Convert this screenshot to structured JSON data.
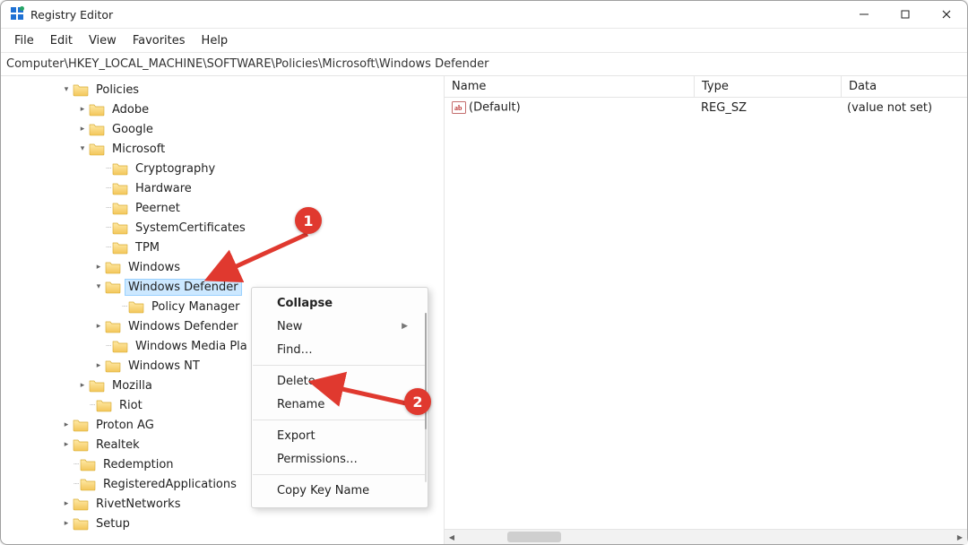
{
  "window": {
    "title": "Registry Editor"
  },
  "menu": {
    "items": [
      "File",
      "Edit",
      "View",
      "Favorites",
      "Help"
    ]
  },
  "addressbar": {
    "path": "Computer\\HKEY_LOCAL_MACHINE\\SOFTWARE\\Policies\\Microsoft\\Windows Defender"
  },
  "tree": {
    "nodes": [
      {
        "pad": 66,
        "chev": "open",
        "label": "Policies",
        "tline": ""
      },
      {
        "pad": 84,
        "chev": "closed",
        "label": "Adobe",
        "tline": ""
      },
      {
        "pad": 84,
        "chev": "closed",
        "label": "Google",
        "tline": ""
      },
      {
        "pad": 84,
        "chev": "open",
        "label": "Microsoft",
        "tline": ""
      },
      {
        "pad": 102,
        "chev": "none",
        "label": "Cryptography",
        "tline": "┈"
      },
      {
        "pad": 102,
        "chev": "none",
        "label": "Hardware",
        "tline": "┈"
      },
      {
        "pad": 102,
        "chev": "none",
        "label": "Peernet",
        "tline": "┈"
      },
      {
        "pad": 102,
        "chev": "none",
        "label": "SystemCertificates",
        "tline": "┈"
      },
      {
        "pad": 102,
        "chev": "none",
        "label": "TPM",
        "tline": "┈"
      },
      {
        "pad": 102,
        "chev": "closed",
        "label": "Windows",
        "tline": ""
      },
      {
        "pad": 102,
        "chev": "open",
        "label": "Windows Defender",
        "tline": "",
        "selected": true
      },
      {
        "pad": 120,
        "chev": "none",
        "label": "Policy Manager",
        "tline": "┈"
      },
      {
        "pad": 102,
        "chev": "closed",
        "label": "Windows Defender Security Center",
        "tline": "",
        "clip": "Windows Defender"
      },
      {
        "pad": 102,
        "chev": "none",
        "label": "Windows Media Player",
        "tline": "┈",
        "clip": "Windows Media Pla"
      },
      {
        "pad": 102,
        "chev": "closed",
        "label": "Windows NT",
        "tline": ""
      },
      {
        "pad": 84,
        "chev": "closed",
        "label": "Mozilla",
        "tline": ""
      },
      {
        "pad": 84,
        "chev": "none",
        "label": "Riot",
        "tline": "┈"
      },
      {
        "pad": 66,
        "chev": "closed",
        "label": "Proton AG",
        "tline": ""
      },
      {
        "pad": 66,
        "chev": "closed",
        "label": "Realtek",
        "tline": ""
      },
      {
        "pad": 66,
        "chev": "none",
        "label": "Redemption",
        "tline": "┈"
      },
      {
        "pad": 66,
        "chev": "none",
        "label": "RegisteredApplications",
        "tline": "┈"
      },
      {
        "pad": 66,
        "chev": "closed",
        "label": "RivetNetworks",
        "tline": ""
      },
      {
        "pad": 66,
        "chev": "closed",
        "label": "Setup",
        "tline": ""
      }
    ]
  },
  "details": {
    "columns": {
      "name": "Name",
      "type": "Type",
      "data": "Data"
    },
    "col_widths": {
      "name": 270,
      "type": 155,
      "data": 160
    },
    "rows": [
      {
        "name": "(Default)",
        "type": "REG_SZ",
        "data": "(value not set)"
      }
    ]
  },
  "ctxmenu": {
    "items": [
      {
        "label": "Collapse",
        "bold": true
      },
      {
        "label": "New",
        "submenu": true
      },
      {
        "label": "Find…"
      },
      {
        "sep": true
      },
      {
        "label": "Delete"
      },
      {
        "label": "Rename"
      },
      {
        "sep": true
      },
      {
        "label": "Export"
      },
      {
        "label": "Permissions…"
      },
      {
        "sep": true
      },
      {
        "label": "Copy Key Name"
      }
    ]
  },
  "annotations": {
    "badge1": "1",
    "badge2": "2",
    "arrow_color": "#e0392f"
  }
}
